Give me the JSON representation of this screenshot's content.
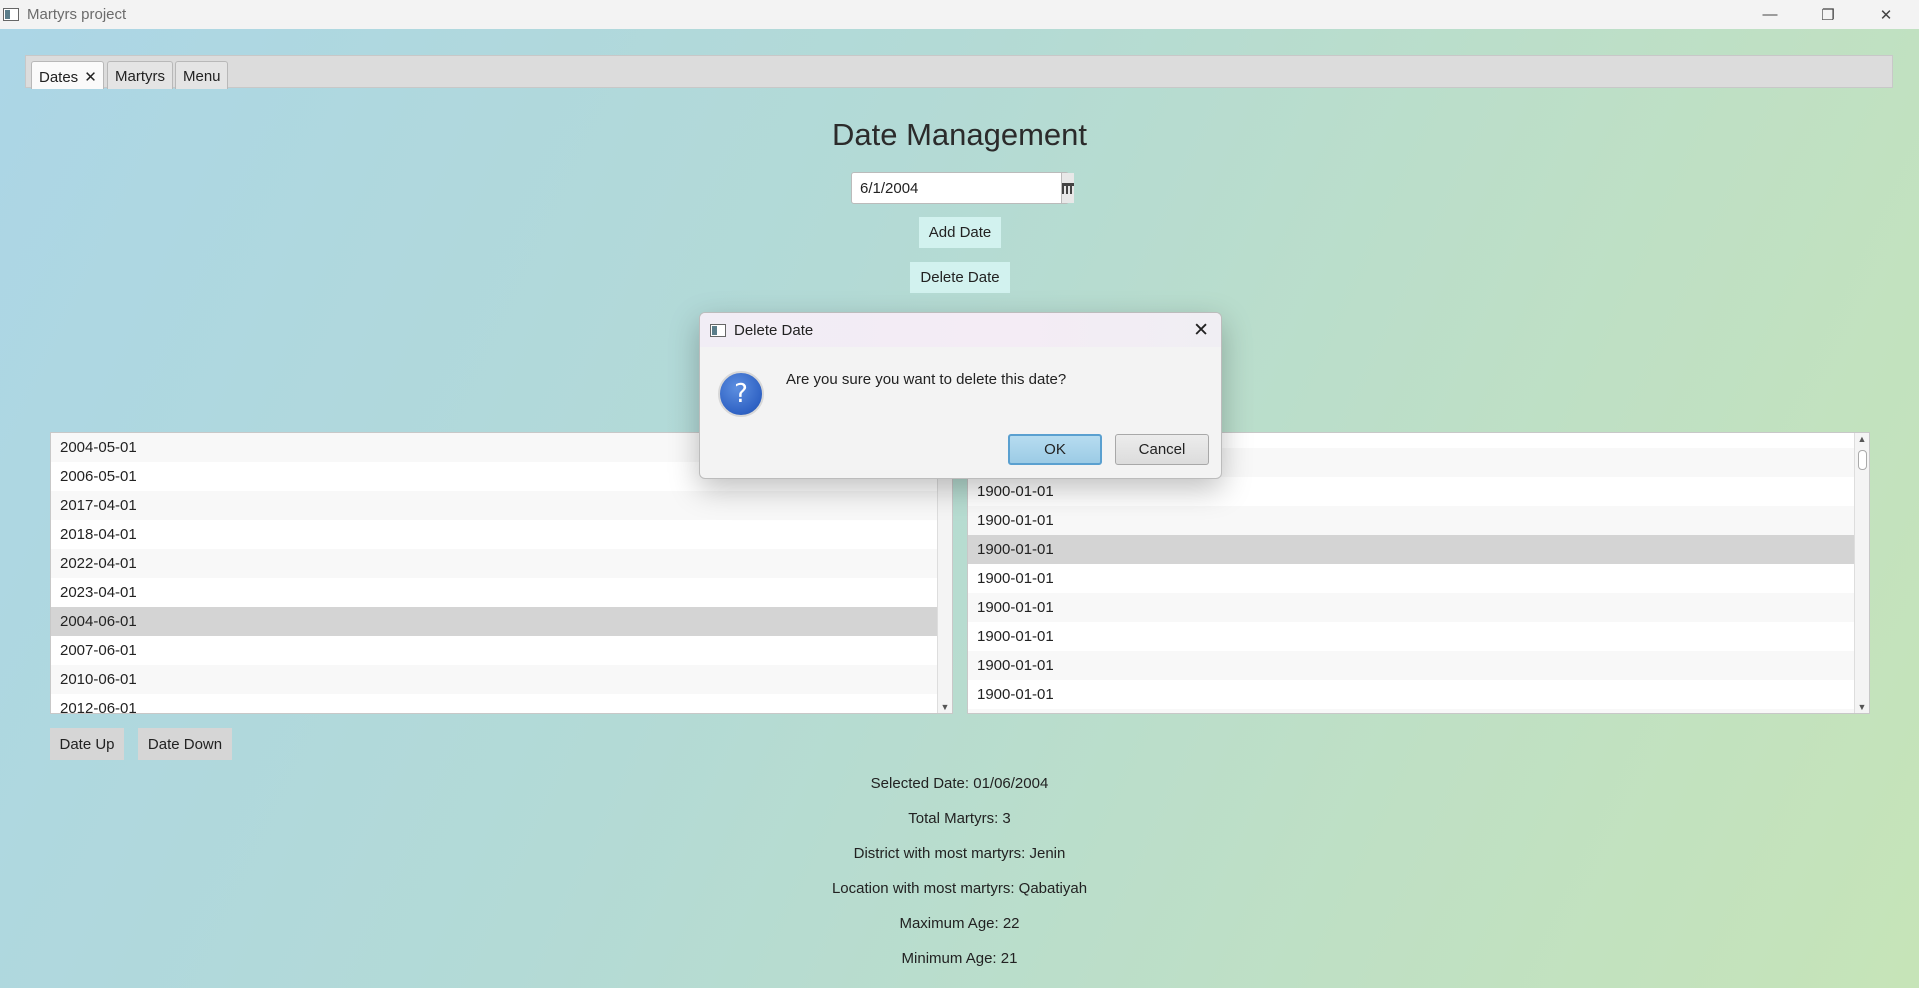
{
  "window": {
    "title": "Martyrs project",
    "minimize": "—",
    "restore": "❐",
    "close": "✕"
  },
  "tabs": [
    {
      "label": "Dates",
      "close": "✕"
    },
    {
      "label": "Martyrs"
    },
    {
      "label": "Menu"
    }
  ],
  "main": {
    "title": "Date Management",
    "date_value": "6/1/2004",
    "add_label": "Add Date",
    "delete_label": "Delete Date"
  },
  "left_list": [
    "2004-05-01",
    "2006-05-01",
    "2017-04-01",
    "2018-04-01",
    "2022-04-01",
    "2023-04-01",
    "2004-06-01",
    "2007-06-01",
    "2010-06-01",
    "2012-06-01"
  ],
  "right_list": [
    "1900-01-01",
    "1900-01-01",
    "1900-01-01",
    "1900-01-01",
    "1900-01-01",
    "1900-01-01",
    "1900-01-01",
    "1900-01-01",
    "1900-01-01",
    "1900-01-01",
    "1900-01-01"
  ],
  "nav": {
    "up_label": "Date Up",
    "down_label": "Date Down"
  },
  "stats": [
    "Selected Date: 01/06/2004",
    "Total Martyrs: 3",
    "District with most martyrs: Jenin",
    "Location with most martyrs: Qabatiyah",
    "Maximum Age: 22",
    "Minimum Age: 21"
  ],
  "dialog": {
    "title": "Delete Date",
    "message": "Are you sure you want to delete this date?",
    "icon_glyph": "?",
    "ok_label": "OK",
    "cancel_label": "Cancel",
    "close": "✕"
  }
}
